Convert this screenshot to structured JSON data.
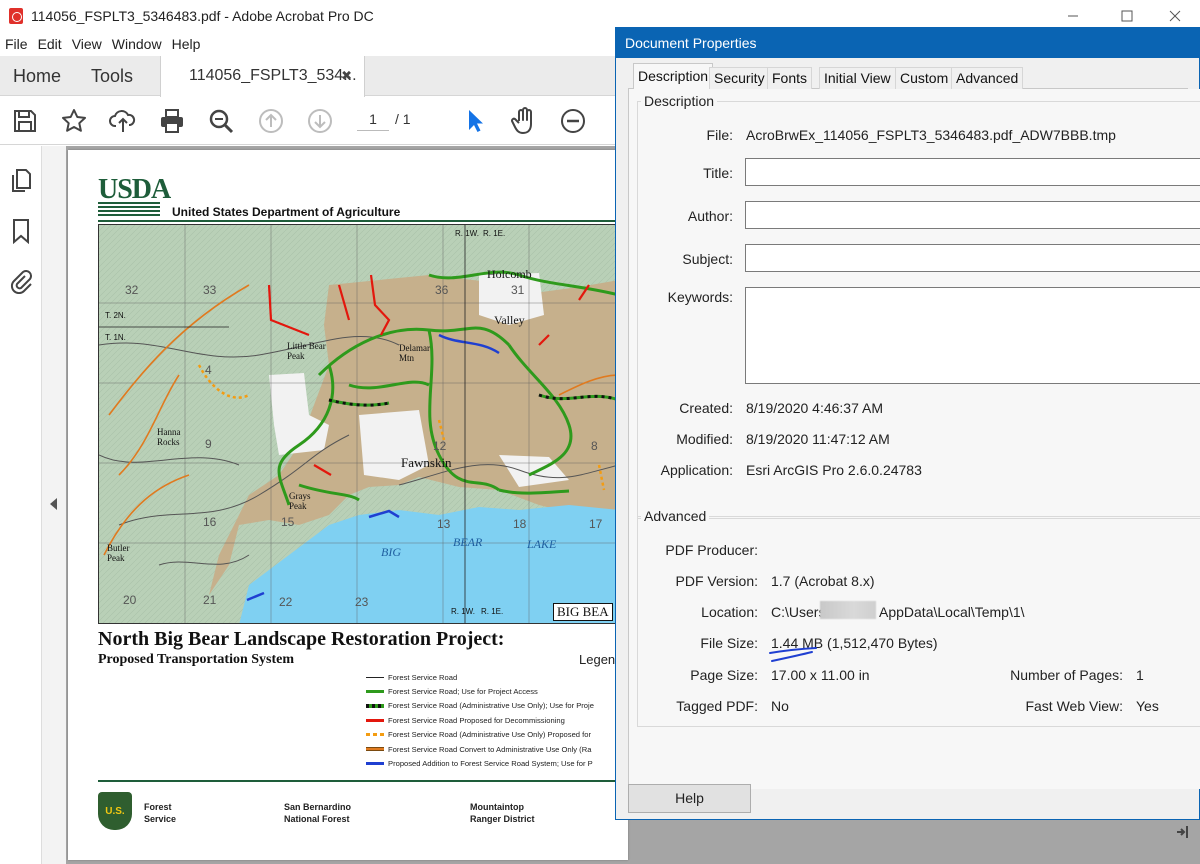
{
  "window": {
    "title": "114056_FSPLT3_5346483.pdf - Adobe Acrobat Pro DC",
    "controls": [
      "minimize-icon",
      "maximize-icon",
      "close-icon"
    ]
  },
  "menu": [
    "File",
    "Edit",
    "View",
    "Window",
    "Help"
  ],
  "tabs": {
    "home": "Home",
    "tools": "Tools",
    "document": "114056_FSPLT3_534...",
    "close_glyph": "✖"
  },
  "toolbar": {
    "icons": [
      "save-icon",
      "star-icon",
      "cloud-upload-icon",
      "print-icon",
      "zoom-search-icon",
      "page-up-icon",
      "page-down-icon",
      "select-cursor-icon",
      "hand-icon",
      "zoom-out-icon"
    ],
    "page_current": "1",
    "page_separator": "/",
    "page_total": "1"
  },
  "left_rail": [
    "pages-icon",
    "bookmark-icon",
    "attachment-icon"
  ],
  "pdf_page": {
    "agency_logo": "USDA",
    "agency": "United States Department of Agriculture",
    "map_labels": {
      "holcomb": "Holcomb",
      "valley": "Valley",
      "fawnskin": "Fawnskin",
      "delamar": "Delamar Mtn",
      "little_bear": "Little Bear Peak",
      "hanna_rocks": "Hanna Rocks",
      "grays_peak": "Grays Peak",
      "butler_peak": "Butler Peak",
      "big": "BIG",
      "bear": "BEAR",
      "lake": "LAKE",
      "big_bear_box": "BIG BEA",
      "range_1w": "R. 1W.",
      "range_1e": "R. 1E.",
      "t2n": "T. 2N.",
      "t1n": "T. 1N.",
      "secs": [
        "32",
        "33",
        "36",
        "31",
        "4",
        "9",
        "16",
        "15",
        "12",
        "13",
        "18",
        "21",
        "22",
        "23",
        "17",
        "8",
        "20"
      ]
    },
    "project_title": "North Big Bear Landscape Restoration Project:",
    "project_subtitle": "Proposed Transportation System",
    "legend_title": "Legen",
    "legend": [
      {
        "label": "Forest Service Road",
        "color": "#222222",
        "style": "solid"
      },
      {
        "label": "Forest Service Road; Use for Project Access",
        "color": "#2e9a1c",
        "style": "solid"
      },
      {
        "label": "Forest Service Road (Administrative Use Only); Use for Proje",
        "color": "#2e9a1c",
        "style": "dash-black"
      },
      {
        "label": "Forest Service Road Proposed for Decommissioning",
        "color": "#e3170d",
        "style": "solid"
      },
      {
        "label": "Forest Service Road (Administrative Use Only) Proposed for",
        "color": "#f39c12",
        "style": "dash"
      },
      {
        "label": "Forest Service Road Convert to Administrative Use Only (Ra",
        "color": "#e07a1f",
        "style": "double"
      },
      {
        "label": "Proposed Addition to Forest Service Road System; Use for P",
        "color": "#1f3fd1",
        "style": "solid"
      }
    ],
    "footer": {
      "badge": "U.S.",
      "col1_line1": "Forest",
      "col1_line2": "Service",
      "col2_line1": "San Bernardino",
      "col2_line2": "National Forest",
      "col3_line1": "Mountaintop",
      "col3_line2": "Ranger District"
    }
  },
  "dialog": {
    "title": "Document Properties",
    "tabs": [
      "Description",
      "Security",
      "Fonts",
      "Initial View",
      "Custom",
      "Advanced"
    ],
    "active_tab": "Description",
    "description_group": "Description",
    "fields": {
      "file_label": "File:",
      "file_value": "AcroBrwEx_114056_FSPLT3_5346483.pdf_ADW7BBB.tmp",
      "title_label": "Title:",
      "title_value": "",
      "author_label": "Author:",
      "author_value": "",
      "subject_label": "Subject:",
      "subject_value": "",
      "keywords_label": "Keywords:",
      "keywords_value": "",
      "created_label": "Created:",
      "created_value": "8/19/2020 4:46:37 AM",
      "modified_label": "Modified:",
      "modified_value": "8/19/2020 11:47:12 AM",
      "application_label": "Application:",
      "application_value": "Esri ArcGIS Pro 2.6.0.24783"
    },
    "advanced_group": "Advanced",
    "advanced": {
      "producer_label": "PDF Producer:",
      "producer_value": "",
      "version_label": "PDF Version:",
      "version_value": "1.7 (Acrobat 8.x)",
      "location_label": "Location:",
      "location_value_a": "C:\\Users",
      "location_value_b": "AppData\\Local\\Temp\\1\\",
      "filesize_label": "File Size:",
      "filesize_value": "1.44 MB (1,512,470 Bytes)",
      "pagesize_label": "Page Size:",
      "pagesize_value": "17.00 x 11.00 in",
      "numpages_label": "Number of Pages:",
      "numpages_value": "1",
      "tagged_label": "Tagged PDF:",
      "tagged_value": "No",
      "fastweb_label": "Fast Web View:",
      "fastweb_value": "Yes"
    },
    "help_button": "Help"
  },
  "colors": {
    "dialog_title_bg": "#0a64b3",
    "acrobat_red": "#e0302a",
    "usda_green": "#1e5d3a",
    "lake_blue": "#7fd0f2",
    "highlight_pen": "#1f3fd1"
  }
}
